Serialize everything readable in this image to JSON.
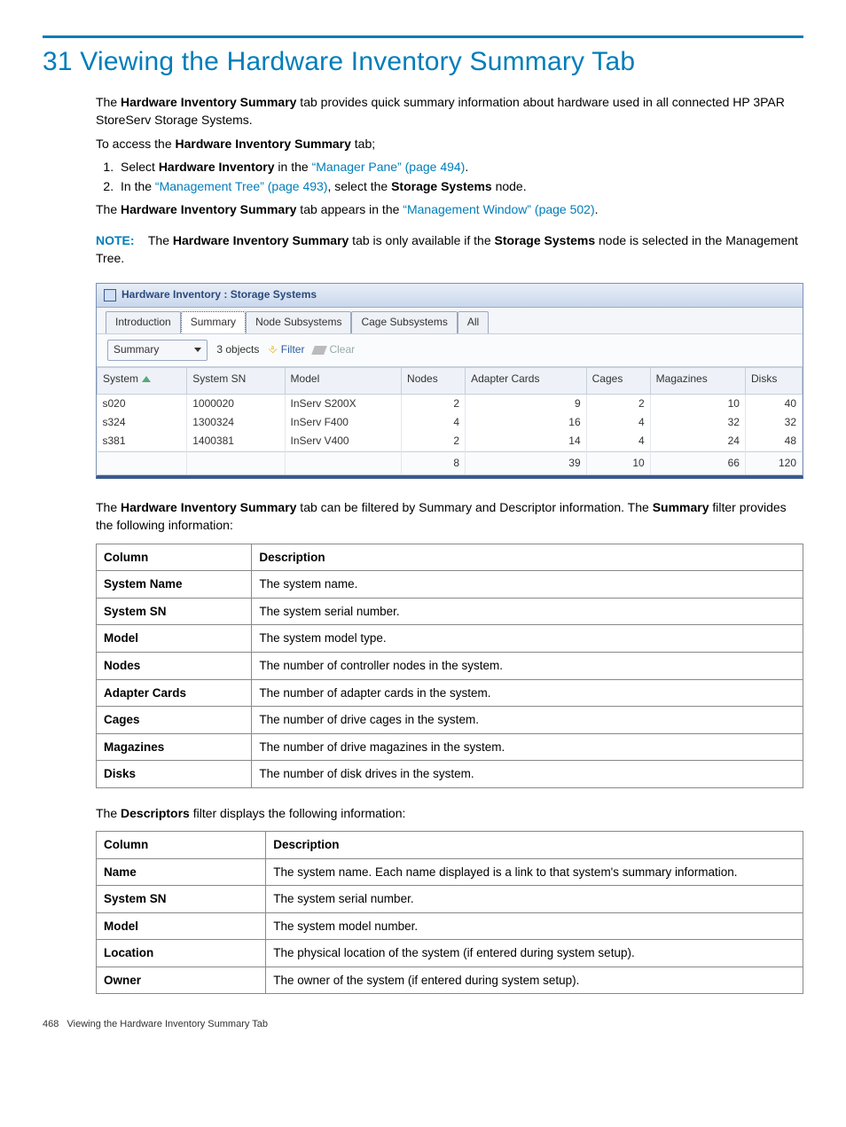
{
  "heading": "31 Viewing the Hardware Inventory Summary Tab",
  "intro": {
    "p1_pre": "The ",
    "p1_bold": "Hardware Inventory Summary",
    "p1_post": " tab provides quick summary information about hardware used in all connected HP 3PAR StoreServ Storage Systems.",
    "access_pre": "To access the ",
    "access_bold": "Hardware Inventory Summary",
    "access_post": " tab;",
    "step1_pre": "Select ",
    "step1_bold": "Hardware Inventory",
    "step1_mid": " in the ",
    "step1_link": "“Manager Pane” (page 494)",
    "step1_post": ".",
    "step2_pre": "In the ",
    "step2_link": "“Management Tree” (page 493)",
    "step2_mid": ", select the ",
    "step2_bold": "Storage Systems",
    "step2_post": " node.",
    "appears_pre": "The ",
    "appears_bold": "Hardware Inventory Summary",
    "appears_mid": " tab appears in the ",
    "appears_link": "“Management Window” (page 502)",
    "appears_post": ".",
    "note_label": "NOTE:",
    "note_pre": "The ",
    "note_bold1": "Hardware Inventory Summary",
    "note_mid": " tab is only available if the ",
    "note_bold2": "Storage Systems",
    "note_post": " node is selected in the Management Tree."
  },
  "app": {
    "title": "Hardware Inventory : Storage Systems",
    "tabs": [
      "Introduction",
      "Summary",
      "Node Subsystems",
      "Cage Subsystems",
      "All"
    ],
    "selected_tab_index": 1,
    "dropdown": "Summary",
    "objects_count": "3 objects",
    "filter_label": "Filter",
    "clear_label": "Clear",
    "columns": [
      "System",
      "System SN",
      "Model",
      "Nodes",
      "Adapter Cards",
      "Cages",
      "Magazines",
      "Disks"
    ],
    "rows": [
      {
        "system": "s020",
        "sn": "1000020",
        "model": "InServ S200X",
        "nodes": "2",
        "adapter": "9",
        "cages": "2",
        "mag": "10",
        "disks": "40"
      },
      {
        "system": "s324",
        "sn": "1300324",
        "model": "InServ F400",
        "nodes": "4",
        "adapter": "16",
        "cages": "4",
        "mag": "32",
        "disks": "32"
      },
      {
        "system": "s381",
        "sn": "1400381",
        "model": "InServ V400",
        "nodes": "2",
        "adapter": "14",
        "cages": "4",
        "mag": "24",
        "disks": "48"
      }
    ],
    "totals": {
      "nodes": "8",
      "adapter": "39",
      "cages": "10",
      "mag": "66",
      "disks": "120"
    }
  },
  "filter_intro": {
    "p1_pre": "The ",
    "p1_bold": "Hardware Inventory Summary",
    "p1_post": " tab can be filtered by Summary and Descriptor information. The ",
    "p1_bold2": "Summary",
    "p1_post2": " filter provides the following information:"
  },
  "summary_table": {
    "headers": [
      "Column",
      "Description"
    ],
    "rows": [
      [
        "System Name",
        "The system name."
      ],
      [
        "System SN",
        "The system serial number."
      ],
      [
        "Model",
        "The system model type."
      ],
      [
        "Nodes",
        "The number of controller nodes in the system."
      ],
      [
        "Adapter Cards",
        "The number of adapter cards in the system."
      ],
      [
        "Cages",
        "The number of drive cages in the system."
      ],
      [
        "Magazines",
        "The number of drive magazines in the system."
      ],
      [
        "Disks",
        "The number of disk drives in the system."
      ]
    ]
  },
  "descriptors_intro": {
    "pre": "The ",
    "bold": "Descriptors",
    "post": " filter displays the following information:"
  },
  "descriptors_table": {
    "headers": [
      "Column",
      "Description"
    ],
    "rows": [
      [
        "Name",
        "The system name. Each name displayed is a link to that system's summary information."
      ],
      [
        "System SN",
        "The system serial number."
      ],
      [
        "Model",
        "The system model number."
      ],
      [
        "Location",
        "The physical location of the system (if entered during system setup)."
      ],
      [
        "Owner",
        "The owner of the system (if entered during system setup)."
      ]
    ]
  },
  "footer": {
    "page": "468",
    "title": "Viewing the Hardware Inventory Summary Tab"
  }
}
